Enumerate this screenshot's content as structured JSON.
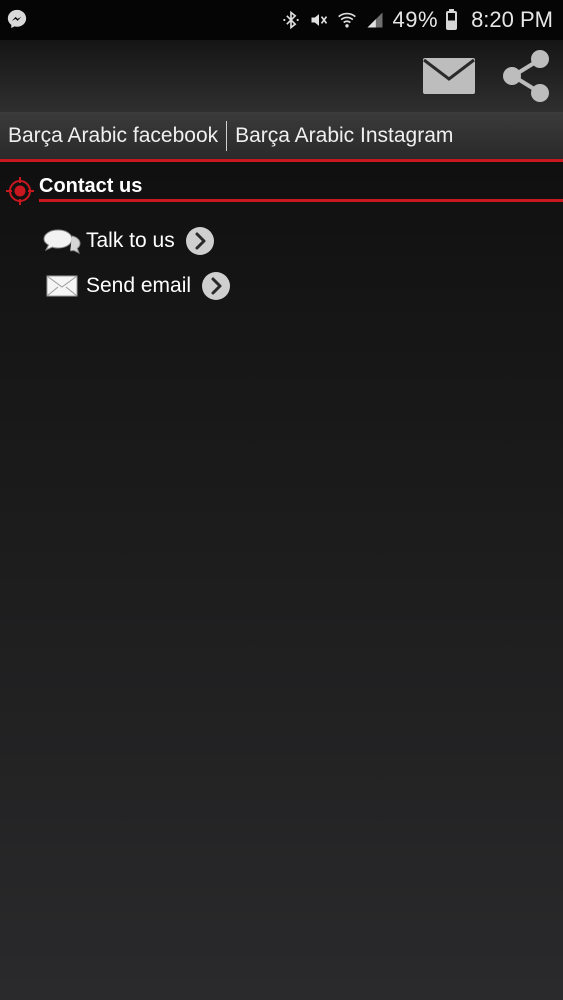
{
  "status_bar": {
    "battery_text": "49%",
    "time": "8:20 PM",
    "icons": [
      "messenger-icon",
      "bluetooth-icon",
      "mute-icon",
      "wifi-icon",
      "signal-icon",
      "battery-icon"
    ]
  },
  "action_bar": {
    "icons": [
      "mail-icon",
      "share-icon"
    ]
  },
  "links": {
    "facebook": "Barça Arabic facebook",
    "instagram": "Barça Arabic Instagram"
  },
  "section": {
    "title": "Contact us"
  },
  "items": [
    {
      "label": "Talk to us",
      "icon": "chat-bubbles-icon"
    },
    {
      "label": "Send email",
      "icon": "envelope-icon"
    }
  ],
  "colors": {
    "accent": "#c8171e",
    "text": "#ffffff",
    "icon_gray": "#bdbdbd"
  }
}
